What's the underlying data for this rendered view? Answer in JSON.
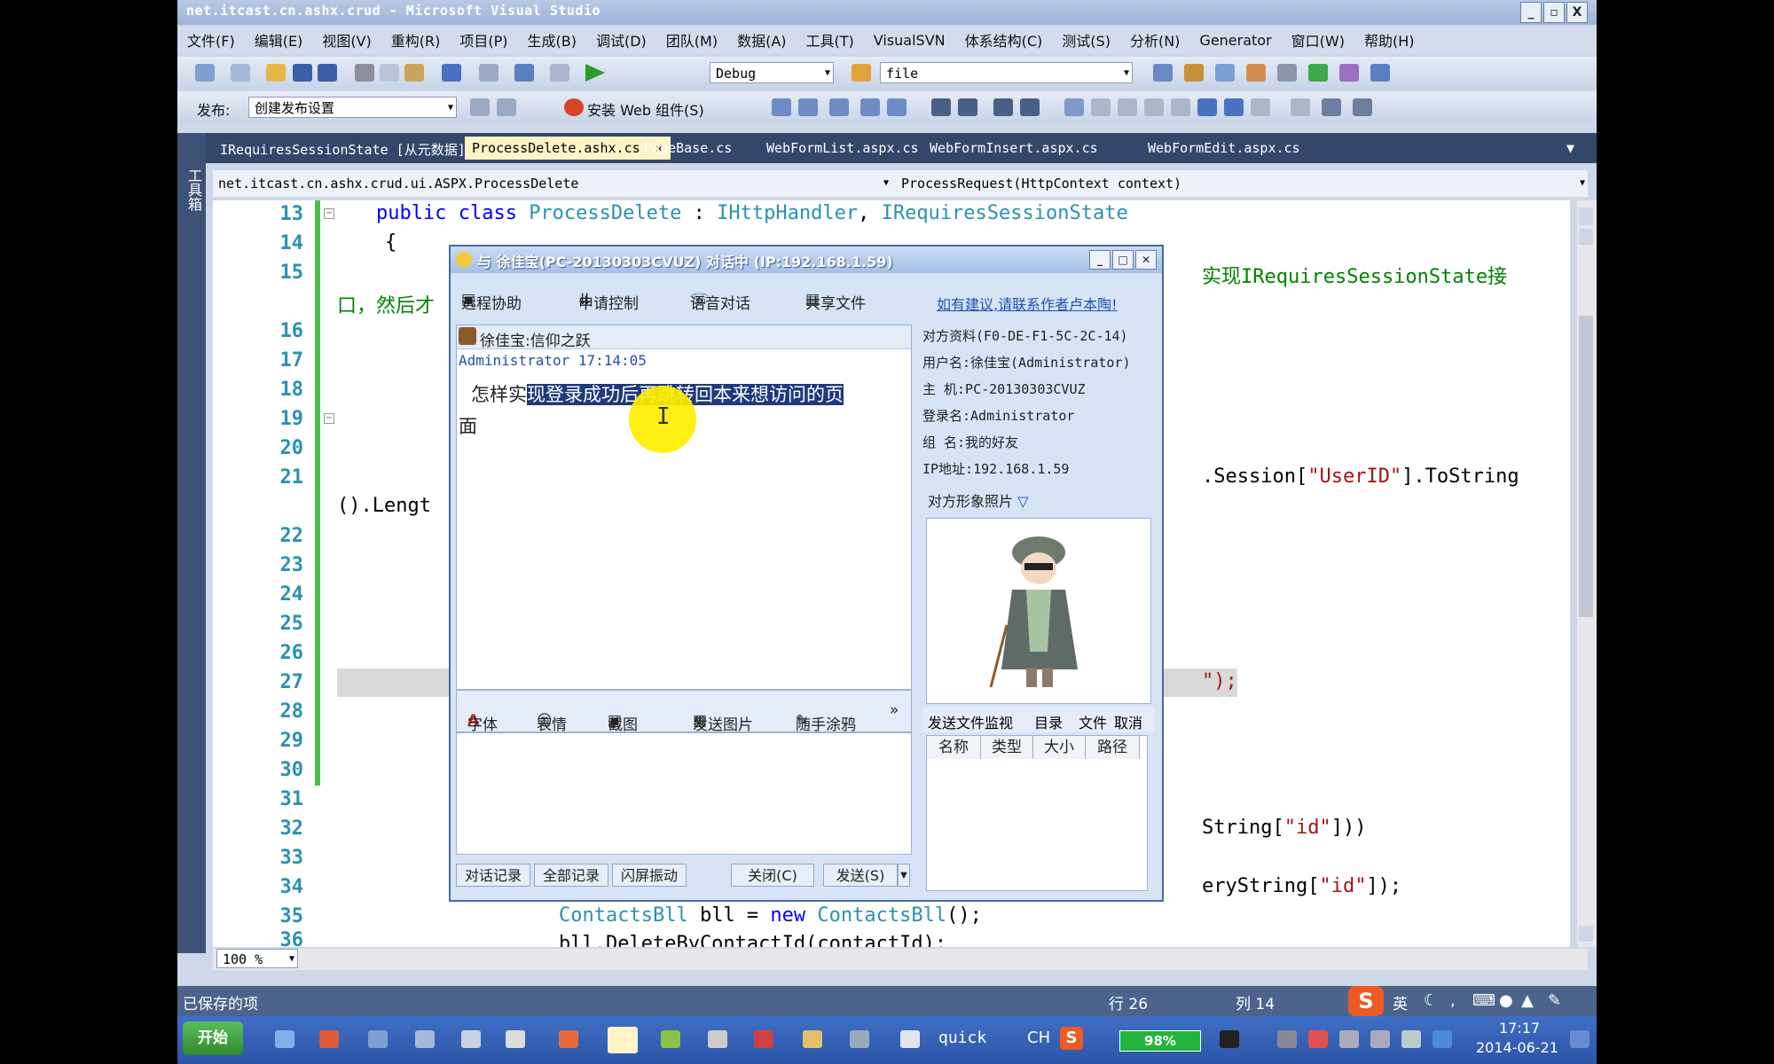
{
  "window": {
    "title": "net.itcast.cn.ashx.crud - Microsoft Visual Studio",
    "controls": [
      "_",
      "▫",
      "X"
    ]
  },
  "menu": [
    "文件(F)",
    "编辑(E)",
    "视图(V)",
    "重构(R)",
    "项目(P)",
    "生成(B)",
    "调试(D)",
    "团队(M)",
    "数据(A)",
    "工具(T)",
    "VisualSVN",
    "体系结构(C)",
    "测试(S)",
    "分析(N)",
    "Generator",
    "窗口(W)",
    "帮助(H)"
  ],
  "toolbar1": {
    "config": "Debug",
    "find": "file"
  },
  "toolbar2": {
    "publish_label": "发布:",
    "publish_value": "创建发布设置",
    "install_label": "安装 Web 组件(S)"
  },
  "toolwindow_label": "工具箱",
  "tabs": [
    "IRequiresSessionState [从元数据]",
    "ProcessDelete.ashx.cs",
    "PageBase.cs",
    "WebFormList.aspx.cs",
    "WebFormInsert.aspx.cs",
    "WebFormEdit.aspx.cs"
  ],
  "nav": {
    "type": "net.itcast.cn.ashx.crud.ui.ASPX.ProcessDelete",
    "member": "ProcessRequest(HttpContext context)"
  },
  "editor": {
    "line_numbers": [
      "13",
      "14",
      "15",
      "16",
      "17",
      "18",
      "19",
      "20",
      "21",
      "22",
      "23",
      "24",
      "25",
      "26",
      "27",
      "28",
      "29",
      "30",
      "31",
      "32",
      "33",
      "34",
      "35",
      "36"
    ],
    "l13_kw": "public class ",
    "l13_type": "ProcessDelete",
    "l13_sep": " : ",
    "l13_if1": "IHttpHandler",
    "l13_comma": ", ",
    "l13_if2": "IRequiresSessionState",
    "l14": "{",
    "l15_right": "实现IRequiresSessionState接",
    "l15_left": "口，然后才",
    "l21_a": ".Session[",
    "l21_str": "\"UserID\"",
    "l21_b": "].ToString",
    "l21_wrap": "().Lengt",
    "l27_tail": "\");",
    "l32_a": "String[",
    "l32_str": "\"id\"",
    "l32_b": "]))",
    "l34_a": "eryString[",
    "l34_str": "\"id\"",
    "l34_b": "]);",
    "l35_type1": "ContactsBll",
    "l35_mid": " bll = ",
    "l35_kw": "new ",
    "l35_type2": "ContactsBll",
    "l35_end": "();",
    "l36": "bll.DeleteByContactId(contactId);"
  },
  "zoom": "100 %",
  "status": {
    "message": "已保存的项",
    "row": "行 26",
    "col": "列 14"
  },
  "chat": {
    "title": "与 徐佳宝(PC-20130303CVUZ) 对话中 (IP:192.168.1.59)",
    "actions": [
      "远程协助",
      "申请控制",
      "语音对话",
      "共享文件"
    ],
    "feedback_link": "如有建议,请联系作者卢本陶!",
    "contact_header": "徐佳宝:信仰之跃",
    "message_meta": "Administrator 17:14:05",
    "message_plain": "怎样实",
    "message_highlight": "现登录成功后再跳转回本来想访问的页",
    "message_line2": "面",
    "tools": [
      "字体",
      "表情",
      "截图",
      "发送图片",
      "随手涂鸦"
    ],
    "bottom_buttons": [
      "对话记录",
      "全部记录",
      "闪屏振动"
    ],
    "close_btn": "关闭(C)",
    "send_btn": "发送(S)",
    "info_header": "对方资料(F0-DE-F1-5C-2C-14)",
    "info": [
      "用户名:徐佳宝(Administrator)",
      "主  机:PC-20130303CVUZ",
      "登录名:Administrator",
      "组  名:我的好友",
      "IP地址:192.168.1.59"
    ],
    "photo_label": "对方形象照片",
    "file_bar": [
      "发送文件监视",
      "目录",
      "文件",
      "取消"
    ],
    "file_cols": [
      "名称",
      "类型",
      "大小",
      "路径"
    ]
  },
  "taskbar": {
    "start": "开始",
    "quick": "quick",
    "lang": "CH",
    "battery": "98%",
    "ime": "英",
    "time": "17:17",
    "date": "2014-06-21"
  },
  "colors": {
    "keyword": "#0000ff",
    "type": "#2b91af",
    "string": "#a31515",
    "comment": "#008000",
    "selection": "#1f3a7a",
    "cursor_highlight": "#ffee00"
  }
}
